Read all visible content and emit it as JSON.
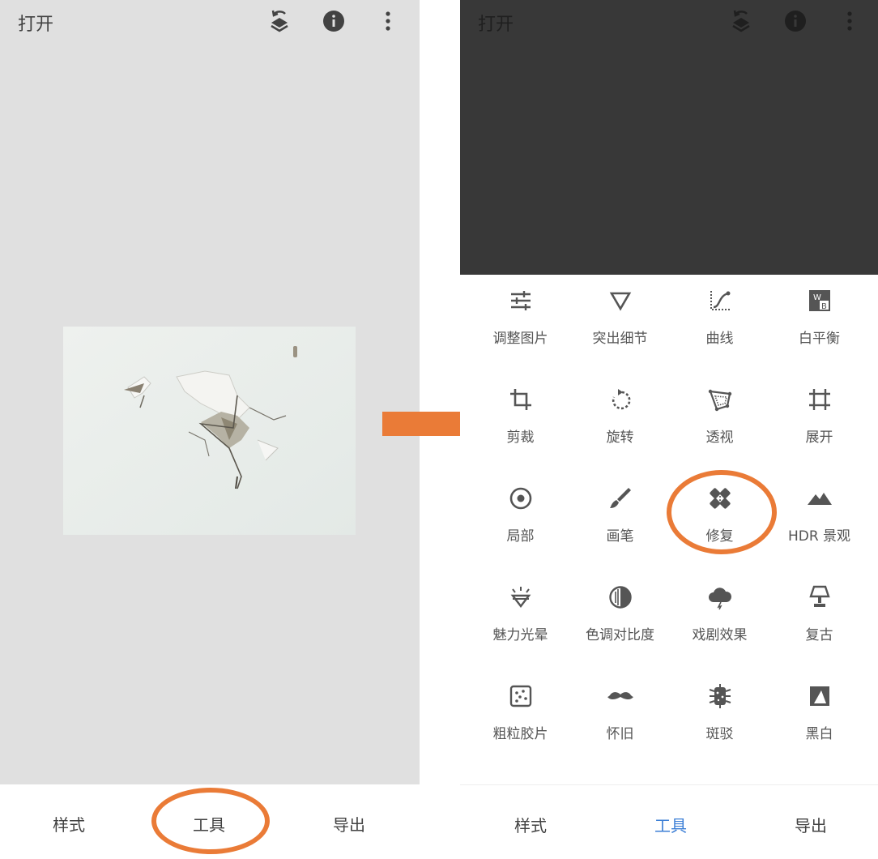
{
  "colors": {
    "accent": "#ea7b37",
    "active_tab": "#3d7fd6",
    "left_background": "#e0e0e0",
    "dark_preview": "#383838",
    "icon_gray": "#555555"
  },
  "left_panel": {
    "title": "打开",
    "top_icons": [
      "layers-undo-icon",
      "info-icon",
      "more-vertical-icon"
    ],
    "photo": "peeling-white-paint-wall",
    "bottom_nav": {
      "styles": "样式",
      "tools": "工具",
      "export": "导出"
    },
    "highlighted_tab": "工具"
  },
  "right_panel": {
    "title": "打开",
    "top_icons": [
      "layers-undo-icon",
      "info-icon",
      "more-vertical-icon"
    ],
    "tools": [
      {
        "label": "调整图片",
        "icon": "tune-sliders-icon"
      },
      {
        "label": "突出细节",
        "icon": "details-triangle-icon"
      },
      {
        "label": "曲线",
        "icon": "curves-icon"
      },
      {
        "label": "白平衡",
        "icon": "white-balance-icon"
      },
      {
        "label": "剪裁",
        "icon": "crop-icon"
      },
      {
        "label": "旋转",
        "icon": "rotate-icon"
      },
      {
        "label": "透视",
        "icon": "perspective-icon"
      },
      {
        "label": "展开",
        "icon": "expand-icon"
      },
      {
        "label": "局部",
        "icon": "selective-target-icon"
      },
      {
        "label": "画笔",
        "icon": "brush-icon"
      },
      {
        "label": "修复",
        "icon": "healing-bandage-icon"
      },
      {
        "label": "HDR 景观",
        "icon": "hdr-mountain-icon"
      },
      {
        "label": "魅力光晕",
        "icon": "glamour-glow-icon"
      },
      {
        "label": "色调对比度",
        "icon": "tonal-contrast-icon"
      },
      {
        "label": "戏剧效果",
        "icon": "drama-cloud-icon"
      },
      {
        "label": "复古",
        "icon": "vintage-lamp-icon"
      },
      {
        "label": "粗粒胶片",
        "icon": "grainy-film-icon"
      },
      {
        "label": "怀旧",
        "icon": "retrolux-mustache-icon"
      },
      {
        "label": "斑驳",
        "icon": "grunge-icon"
      },
      {
        "label": "黑白",
        "icon": "black-white-icon"
      }
    ],
    "bottom_nav": {
      "styles": "样式",
      "tools": "工具",
      "export": "导出"
    },
    "active_tab": "工具",
    "highlighted_tool": "修复"
  }
}
